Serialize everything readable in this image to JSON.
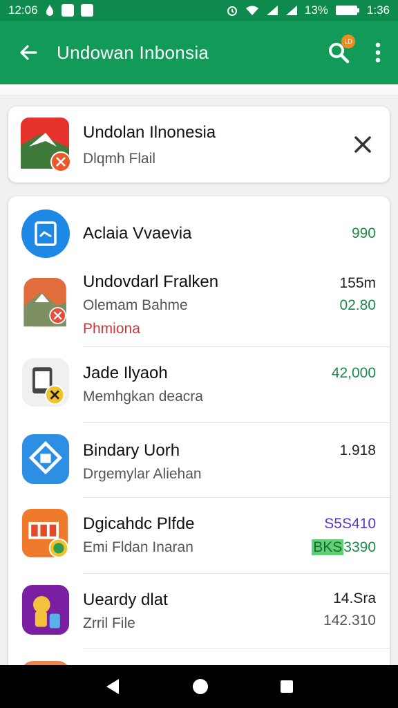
{
  "status_bar": {
    "time": "12:06",
    "battery_percent": "13%",
    "clock_right": "1:36",
    "icons": [
      "water-drop-icon",
      "notification-b-icon",
      "notification-app-icon",
      "alarm-icon",
      "wifi-icon",
      "signal-icon",
      "signal-icon",
      "battery-icon"
    ]
  },
  "app_bar": {
    "title": "Undowan Inbonsia",
    "search_badge": "LD",
    "back_icon": "back-arrow-icon",
    "search_icon": "search-icon",
    "more_icon": "more-vert-icon"
  },
  "hero": {
    "title": "Undolan Ilnonesia",
    "subtitle": "Dlqmh Flail",
    "icon": "red-app-icon"
  },
  "list": [
    {
      "title": "Aclaia Vvaevia",
      "sub": "",
      "promo": "",
      "value": "990",
      "value2": "",
      "value_color": "green",
      "icon": "blue-clipboard-icon"
    },
    {
      "title": "Undovdarl Fralken",
      "sub": "Olemam Bahme",
      "promo": "Phmiona",
      "value": "155m",
      "value2": "02.80",
      "value_color": "dark",
      "icon": "orange-landscape-icon"
    },
    {
      "title": "Jade Ilyaoh",
      "sub": "Memhgkan deacra",
      "promo": "",
      "value": "42,000",
      "value2": "",
      "value_color": "green",
      "icon": "phone-app-icon"
    },
    {
      "title": "Bindary Uorh",
      "sub": "Drgemylar Aliehan",
      "promo": "",
      "value": "1.918",
      "value2": "",
      "value_color": "dark",
      "icon": "blue-home-icon"
    },
    {
      "title": "Dgicahdc Plfde",
      "sub": "Emi Fldan Inaran",
      "promo": "",
      "value": "S5S410",
      "value2_highlight": "BKS",
      "value2": "3390",
      "value_color": "purple",
      "icon": "orange-calendar-icon"
    },
    {
      "title": "Ueardy dlat",
      "sub": "Zrril File",
      "promo": "",
      "value": "14.Sra",
      "value2": "142.310",
      "value_color": "dark",
      "icon": "purple-character-icon"
    }
  ],
  "colors": {
    "app_bar": "#129a58",
    "status_bar": "#0f8a4e",
    "green_text": "#1b8a4a",
    "promo_red": "#d0343a",
    "purple_text": "#5a34c9"
  }
}
